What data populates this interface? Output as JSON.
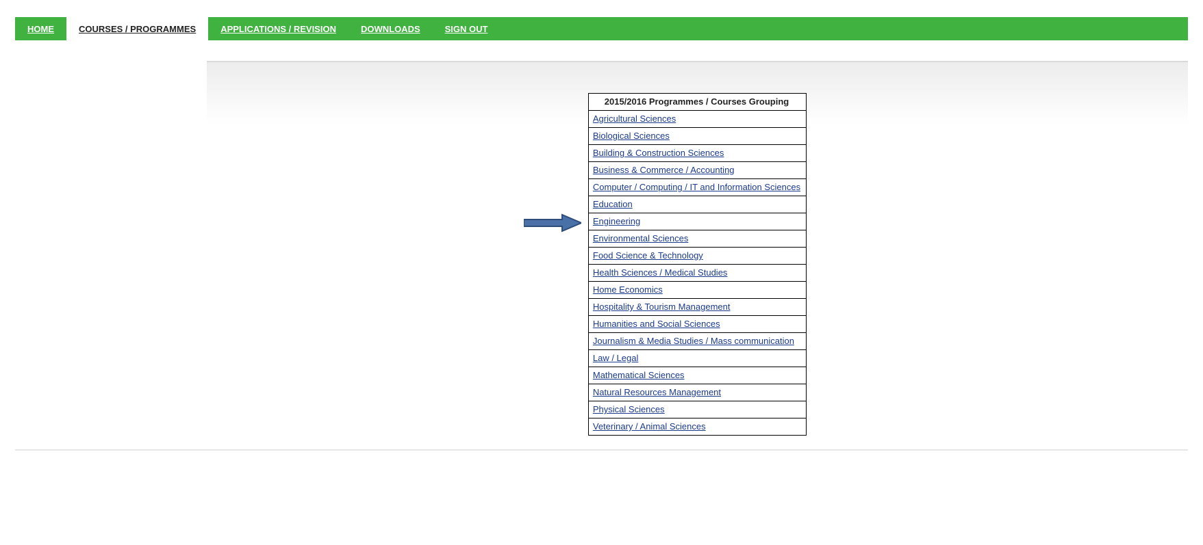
{
  "nav": {
    "items": [
      {
        "label": "HOME",
        "active": false
      },
      {
        "label": "COURSES / PROGRAMMES",
        "active": true
      },
      {
        "label": "APPLICATIONS / REVISION",
        "active": false
      },
      {
        "label": "DOWNLOADS",
        "active": false
      },
      {
        "label": "SIGN OUT",
        "active": false
      }
    ]
  },
  "table": {
    "heading": "2015/2016 Programmes / Courses Grouping",
    "rows": [
      "Agricultural Sciences",
      "Biological Sciences",
      "Building & Construction Sciences",
      "Business & Commerce / Accounting",
      "Computer / Computing / IT and Information Sciences",
      "Education",
      "Engineering",
      "Environmental Sciences",
      "Food Science & Technology",
      "Health Sciences / Medical Studies",
      "Home Economics",
      "Hospitality & Tourism Management",
      "Humanities and Social Sciences",
      "Journalism & Media Studies / Mass communication",
      "Law / Legal",
      "Mathematical Sciences",
      "Natural Resources Management",
      "Physical Sciences",
      "Veterinary / Animal Sciences"
    ]
  },
  "arrow": {
    "target_row_index": 6,
    "fill": "#4a70a8",
    "stroke": "#2f4d7a"
  }
}
